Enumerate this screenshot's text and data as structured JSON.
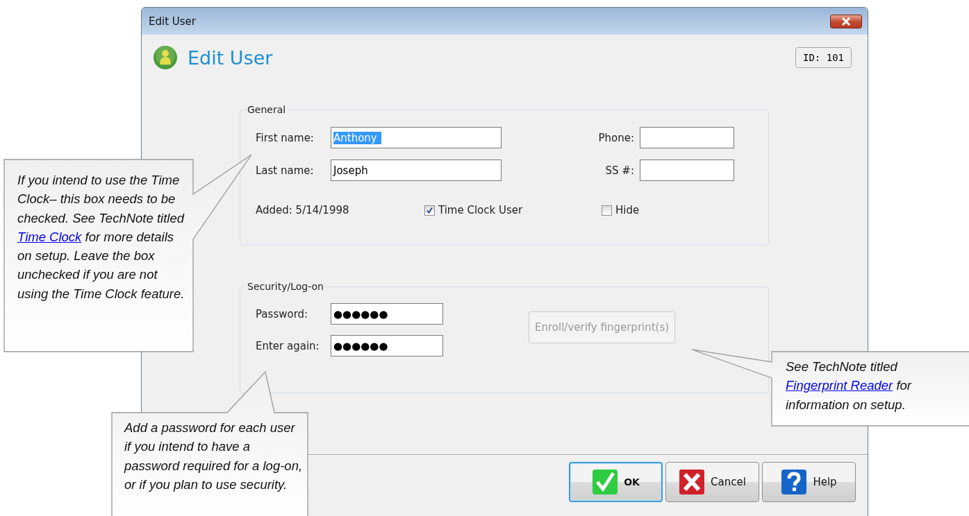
{
  "window": {
    "title": "Edit User"
  },
  "header": {
    "title": "Edit User",
    "id_badge": "ID: 101"
  },
  "general": {
    "legend": "General",
    "fields": [
      {
        "label": "First name:",
        "value": "Anthony",
        "highlighted": true
      },
      {
        "label": "Phone:"
      },
      {
        "label": "Last name:",
        "value": "Joseph",
        "highlighted": false
      },
      {
        "label": "SS #:"
      }
    ],
    "added": "Added: 5/14/1998",
    "checkboxes": [
      {
        "label": "Time Clock User",
        "checked": true
      },
      {
        "label": "Hide",
        "checked": false
      }
    ]
  },
  "security": {
    "legend": "Security/Log-on",
    "fields": [
      {
        "label": "Password:",
        "value": "●●●●●●"
      },
      {
        "label": "Enter again:",
        "value": "●●●●●●"
      }
    ],
    "fingerprint_button": {
      "label": "Enroll/verify fingerprint(s)",
      "disabled": true
    }
  },
  "buttons": [
    {
      "label": "OK",
      "kind": "ok",
      "default": true
    },
    {
      "label": "Cancel",
      "kind": "cancel",
      "default": false
    },
    {
      "label": "Help",
      "kind": "help",
      "default": false
    }
  ],
  "callouts": [
    {
      "before": "If you intend to use the Time Clock– this box needs to be checked. See TechNote titled ",
      "link": "Time Clock",
      "after": " for more details on setup. Leave the box unchecked if you are not using the Time Clock feature."
    },
    {
      "before": "Add a password for each user if you intend to have a password required for a log-on, or if you plan to use security."
    },
    {
      "before": "See TechNote titled ",
      "link": "Fingerprint Reader",
      "after": " for information on setup."
    }
  ]
}
